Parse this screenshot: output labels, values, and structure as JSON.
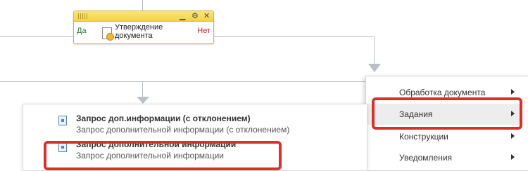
{
  "node": {
    "title_line1": "Утверждение",
    "title_line2": "документа",
    "yes_label": "Да",
    "no_label": "Нет",
    "minimize_glyph": "▁",
    "settings_glyph": "⚙",
    "close_glyph": "✕"
  },
  "menu": {
    "items": [
      {
        "label": "Обработка документа",
        "icon": "chevron-right-icon"
      },
      {
        "label": "Задания",
        "icon": "chevron-right-icon"
      },
      {
        "label": "Конструкции",
        "icon": "chevron-right-icon"
      },
      {
        "label": "Уведомления",
        "icon": "chevron-right-icon"
      }
    ]
  },
  "submenu": {
    "items": [
      {
        "title": "Запрос доп.информации (с отклонением)",
        "description": "Запрос дополнительной информации (с отклонением)"
      },
      {
        "title": "Запрос дополнительной информации",
        "description": "Запрос дополнительной информации"
      }
    ]
  },
  "colors": {
    "highlight": "#d9302c",
    "node_header": "#f4d24a",
    "connector": "#b9c1c6"
  }
}
